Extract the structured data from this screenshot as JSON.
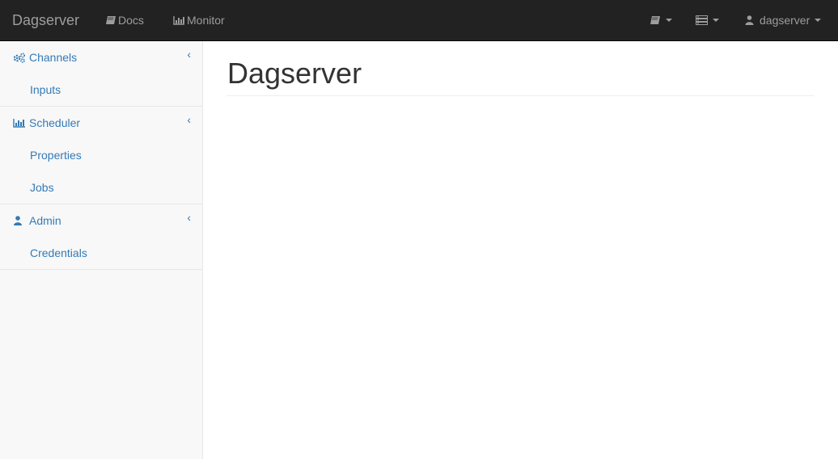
{
  "navbar": {
    "brand": "Dagserver",
    "links": [
      {
        "label": "Docs",
        "icon": "book-icon"
      },
      {
        "label": "Monitor",
        "icon": "bar-chart-icon"
      }
    ],
    "right": {
      "book_menu_icon": "book-icon",
      "list_menu_icon": "list-icon",
      "user_label": "dagserver",
      "user_icon": "user-icon"
    }
  },
  "sidebar": {
    "groups": [
      {
        "label": "Channels",
        "icon": "cogs-icon",
        "chevron": "‹",
        "items": [
          "Inputs"
        ]
      },
      {
        "label": "Scheduler",
        "icon": "bar-chart-icon",
        "chevron": "‹",
        "items": [
          "Properties",
          "Jobs"
        ]
      },
      {
        "label": "Admin",
        "icon": "user-icon",
        "chevron": "‹",
        "items": [
          "Credentials"
        ]
      }
    ]
  },
  "main": {
    "title": "Dagserver"
  },
  "colors": {
    "navbar_bg": "#222222",
    "navbar_text": "#9d9d9d",
    "link": "#337ab7",
    "sidebar_bg": "#f8f8f8"
  }
}
